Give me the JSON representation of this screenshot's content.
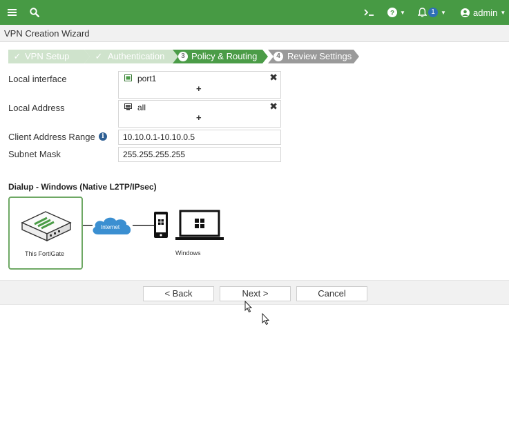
{
  "topbar": {
    "notification_count": "1",
    "user_label": "admin"
  },
  "window": {
    "title": "VPN Creation Wizard"
  },
  "steps": [
    {
      "label": "VPN Setup",
      "state": "done"
    },
    {
      "label": "Authentication",
      "state": "done"
    },
    {
      "label": "Policy & Routing",
      "number": "3",
      "state": "active"
    },
    {
      "label": "Review Settings",
      "number": "4",
      "state": "future"
    }
  ],
  "form": {
    "local_interface": {
      "label": "Local interface",
      "value": "port1",
      "add_symbol": "+"
    },
    "local_address": {
      "label": "Local Address",
      "value": "all",
      "add_symbol": "+"
    },
    "client_address_range": {
      "label": "Client Address Range",
      "value": "10.10.0.1-10.10.0.5"
    },
    "subnet_mask": {
      "label": "Subnet Mask",
      "value": "255.255.255.255"
    }
  },
  "diagram": {
    "title": "Dialup - Windows (Native L2TP/IPsec)",
    "fortigate_label": "This FortiGate",
    "cloud_label": "Internet",
    "client_label": "Windows"
  },
  "buttons": {
    "back": "< Back",
    "next": "Next >",
    "cancel": "Cancel"
  },
  "colors": {
    "topbar": "#479a44",
    "step_done": "#cfe3cc",
    "step_active": "#4b9c47",
    "step_future": "#9a9a9a",
    "cloud": "#3b8fd1",
    "fortigate_border": "#6ea864"
  }
}
